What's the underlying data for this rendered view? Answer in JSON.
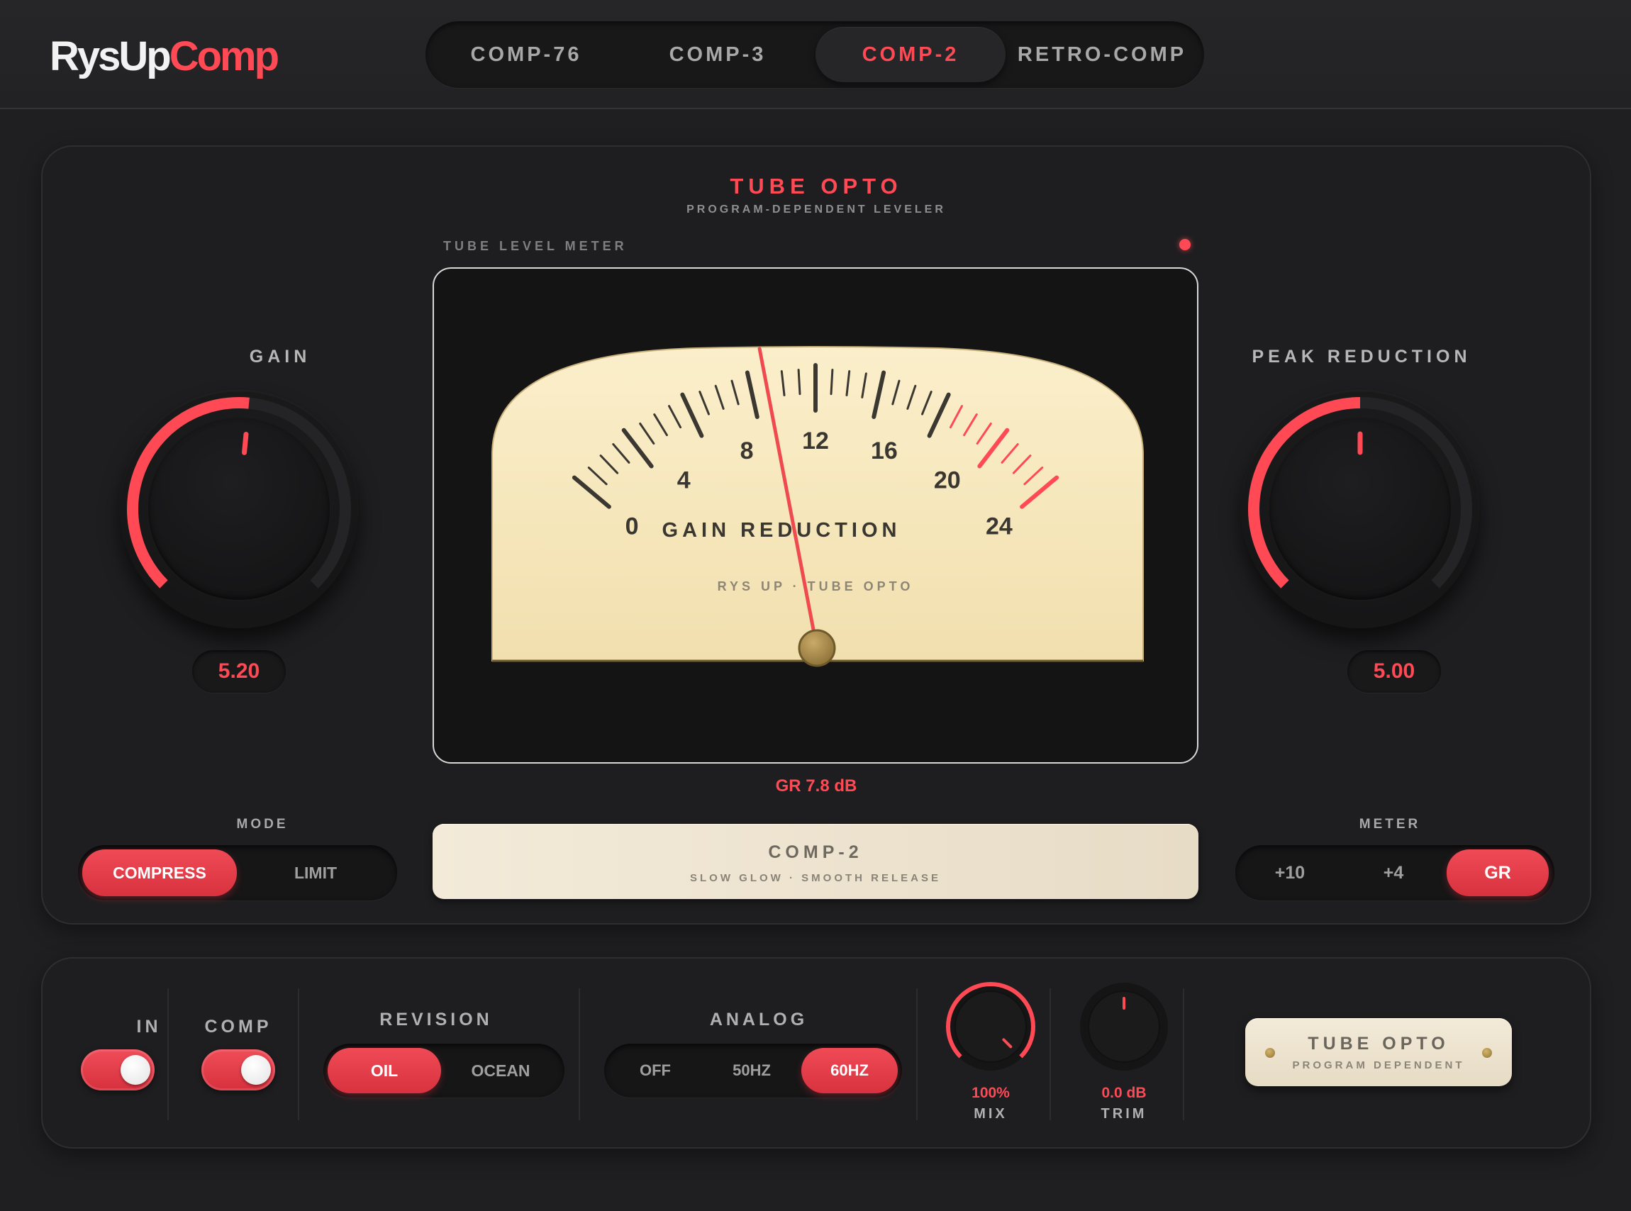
{
  "app": {
    "logo_part1": "RysUp",
    "logo_part2": "Comp",
    "accent_color": "#ff4a55"
  },
  "tabs": [
    {
      "label": "COMP-76",
      "active": false
    },
    {
      "label": "COMP-3",
      "active": false
    },
    {
      "label": "COMP-2",
      "active": true
    },
    {
      "label": "RETRO-COMP",
      "active": false
    }
  ],
  "header": {
    "title": "TUBE OPTO",
    "subtitle": "PROGRAM-DEPENDENT LEVELER"
  },
  "gain": {
    "label": "GAIN",
    "value": "5.20",
    "level": 0.52
  },
  "peak_reduction": {
    "label": "PEAK REDUCTION",
    "value": "5.00",
    "level": 0.5
  },
  "meter": {
    "label": "TUBE LEVEL METER",
    "scale": [
      "0",
      "4",
      "8",
      "12",
      "16",
      "20",
      "24"
    ],
    "caption": "GAIN REDUCTION",
    "brand": "RYS UP · TUBE OPTO",
    "gr_readout": "GR 7.8 dB",
    "gr_value_db": 7.8,
    "scale_max_db": 24
  },
  "mode": {
    "label": "MODE",
    "options": [
      "COMPRESS",
      "LIMIT"
    ],
    "selected": "COMPRESS"
  },
  "preset": {
    "title": "COMP-2",
    "subtitle": "SLOW GLOW · SMOOTH RELEASE"
  },
  "meter_select": {
    "label": "METER",
    "options": [
      "+10",
      "+4",
      "GR"
    ],
    "selected": "GR"
  },
  "bottom": {
    "in_label": "IN",
    "comp_label": "COMP",
    "revision": {
      "label": "REVISION",
      "options": [
        "OIL",
        "OCEAN"
      ],
      "selected": "OIL"
    },
    "analog": {
      "label": "ANALOG",
      "options": [
        "OFF",
        "50HZ",
        "60HZ"
      ],
      "selected": "60HZ"
    },
    "mix": {
      "label": "MIX",
      "value": "100%",
      "level": 1.0
    },
    "trim": {
      "label": "TRIM",
      "value": "0.0 dB",
      "level": 0.5
    },
    "badge_title": "TUBE OPTO",
    "badge_sub": "PROGRAM DEPENDENT"
  }
}
